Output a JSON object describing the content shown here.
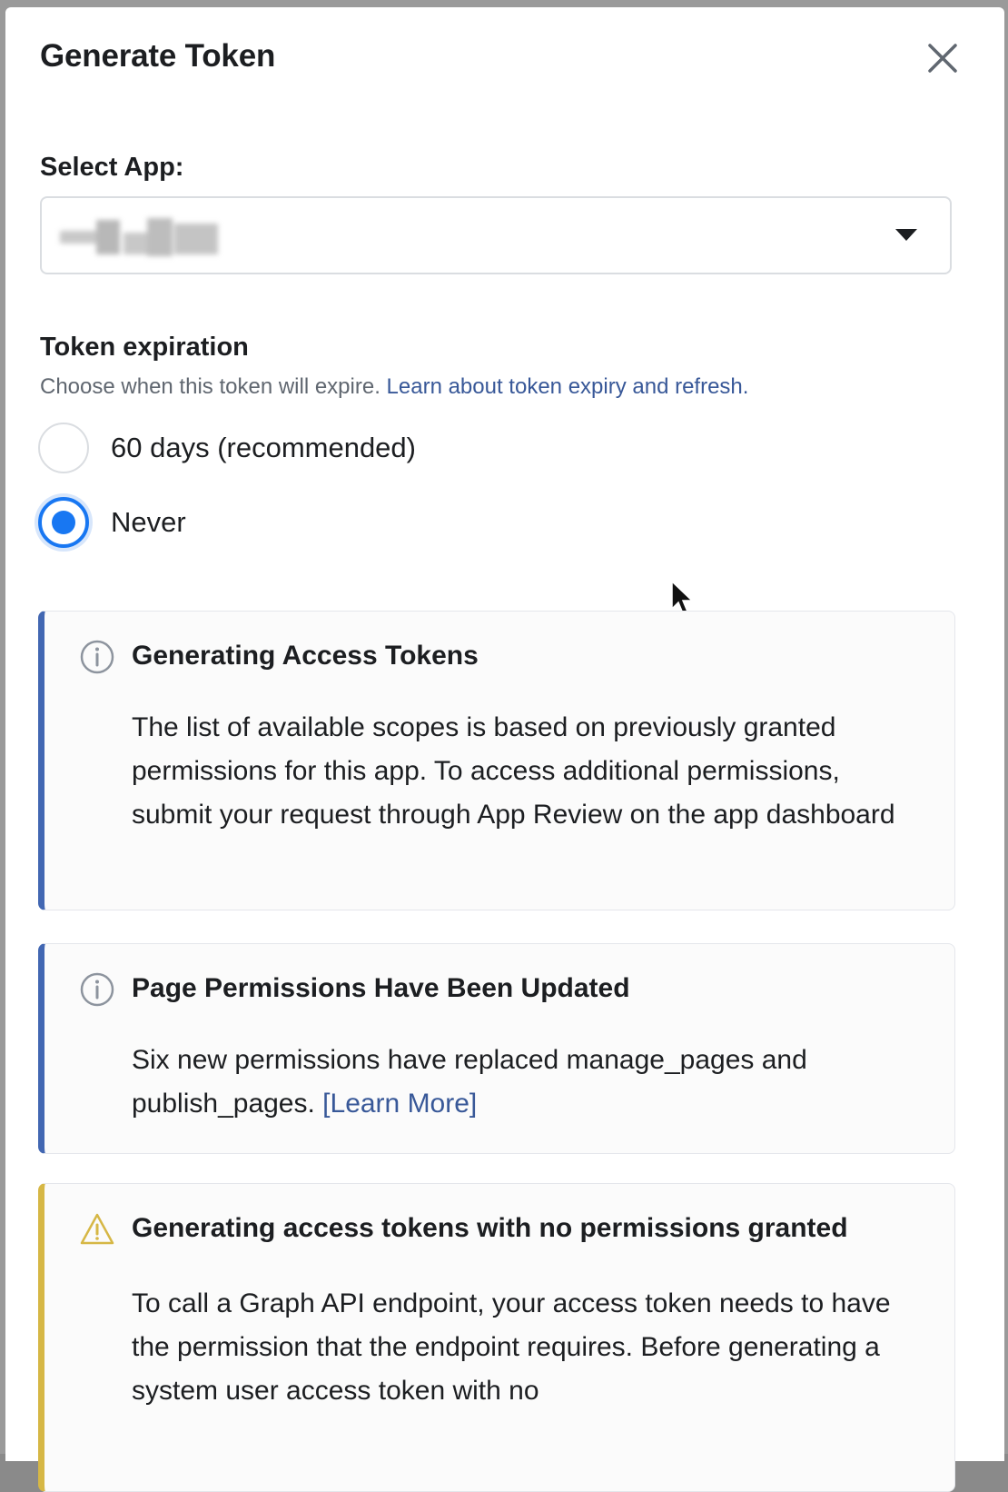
{
  "dialog": {
    "title": "Generate Token",
    "close_icon": "close-icon"
  },
  "app_select": {
    "label": "Select App:",
    "selected_value": "",
    "caret_icon": "caret-down-icon"
  },
  "expiration": {
    "label": "Token expiration",
    "helper": "Choose when this token will expire.",
    "helper_link": "Learn about token expiry and refresh.",
    "options": [
      {
        "label": "60 days (recommended)",
        "checked": false
      },
      {
        "label": "Never",
        "checked": true
      }
    ]
  },
  "callouts": [
    {
      "type": "info",
      "icon": "info-icon",
      "title": "Generating Access Tokens",
      "body": "The list of available scopes is based on previously granted permissions for this app. To access additional permissions, submit your request through App Review on the app dashboard"
    },
    {
      "type": "info",
      "icon": "info-icon",
      "title": "Page Permissions Have Been Updated",
      "body": "Six new permissions have replaced manage_pages and publish_pages.",
      "link": "[Learn More]"
    },
    {
      "type": "warning",
      "icon": "warning-icon",
      "title": "Generating access tokens with no permissions granted",
      "body": "To call a Graph API endpoint, your access token needs to have the permission that the endpoint requires. Before generating a system user access token with no"
    }
  ],
  "colors": {
    "accent": "#1877f2",
    "link": "#385898",
    "info_border": "#4267b2",
    "warning_border": "#d6b745"
  }
}
